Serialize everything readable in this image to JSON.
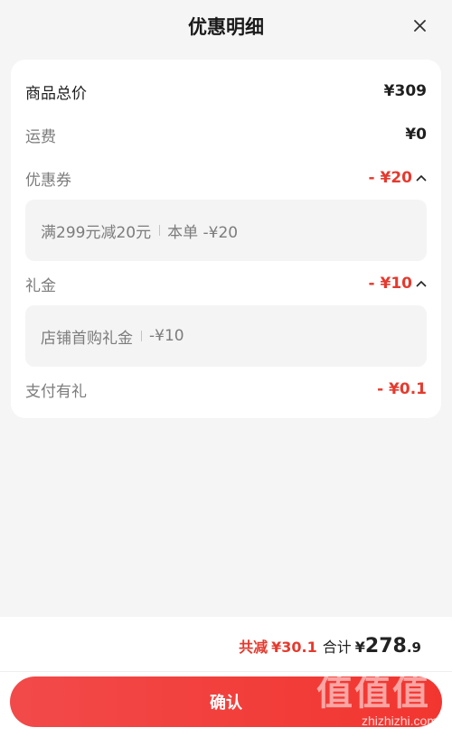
{
  "header": {
    "title": "优惠明细",
    "close_icon": "close-icon"
  },
  "summary": {
    "goods_total_label": "商品总价",
    "goods_total_value": "¥309",
    "shipping_label": "运费",
    "shipping_value": "¥0",
    "coupon_label": "优惠券",
    "coupon_value": "- ¥20",
    "coupon_detail_name": "满299元减20元",
    "coupon_detail_amount": "本单 -¥20",
    "gift_label": "礼金",
    "gift_value": "- ¥10",
    "gift_detail_name": "店铺首购礼金",
    "gift_detail_amount": "-¥10",
    "payment_gift_label": "支付有礼",
    "payment_gift_value": "- ¥0.1"
  },
  "footer": {
    "saved_label": "共减",
    "saved_value": "¥30.1",
    "total_label": "合计",
    "total_currency": "¥",
    "total_int": "278",
    "total_dec": ".9",
    "confirm_label": "确认"
  },
  "watermark": {
    "glyphs": "值值值",
    "text": "zhizhizhi.com"
  },
  "colors": {
    "accent_red": "#e53a2e",
    "button_red": "#f2352f",
    "background": "#f5f5f5"
  }
}
